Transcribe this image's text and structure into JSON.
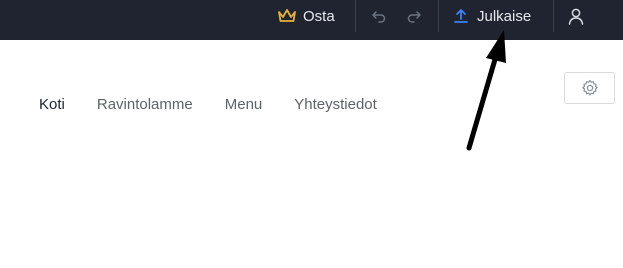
{
  "topbar": {
    "buy_label": "Osta",
    "publish_label": "Julkaise",
    "icons": {
      "buy": "crown-icon",
      "undo": "undo-icon",
      "redo": "redo-icon",
      "publish": "upload-icon",
      "user": "user-icon"
    }
  },
  "nav": {
    "items": [
      {
        "label": "Koti",
        "active": true
      },
      {
        "label": "Ravintolamme",
        "active": false
      },
      {
        "label": "Menu",
        "active": false
      },
      {
        "label": "Yhteystiedot",
        "active": false
      }
    ]
  },
  "settings": {
    "icon": "gear-icon"
  },
  "colors": {
    "topbar_bg": "#1f2430",
    "crown": "#e8b23a",
    "upload": "#3b82f6",
    "text_light": "#e6e8ee",
    "nav_active": "#1f2430",
    "nav_inactive": "#5f6368"
  }
}
